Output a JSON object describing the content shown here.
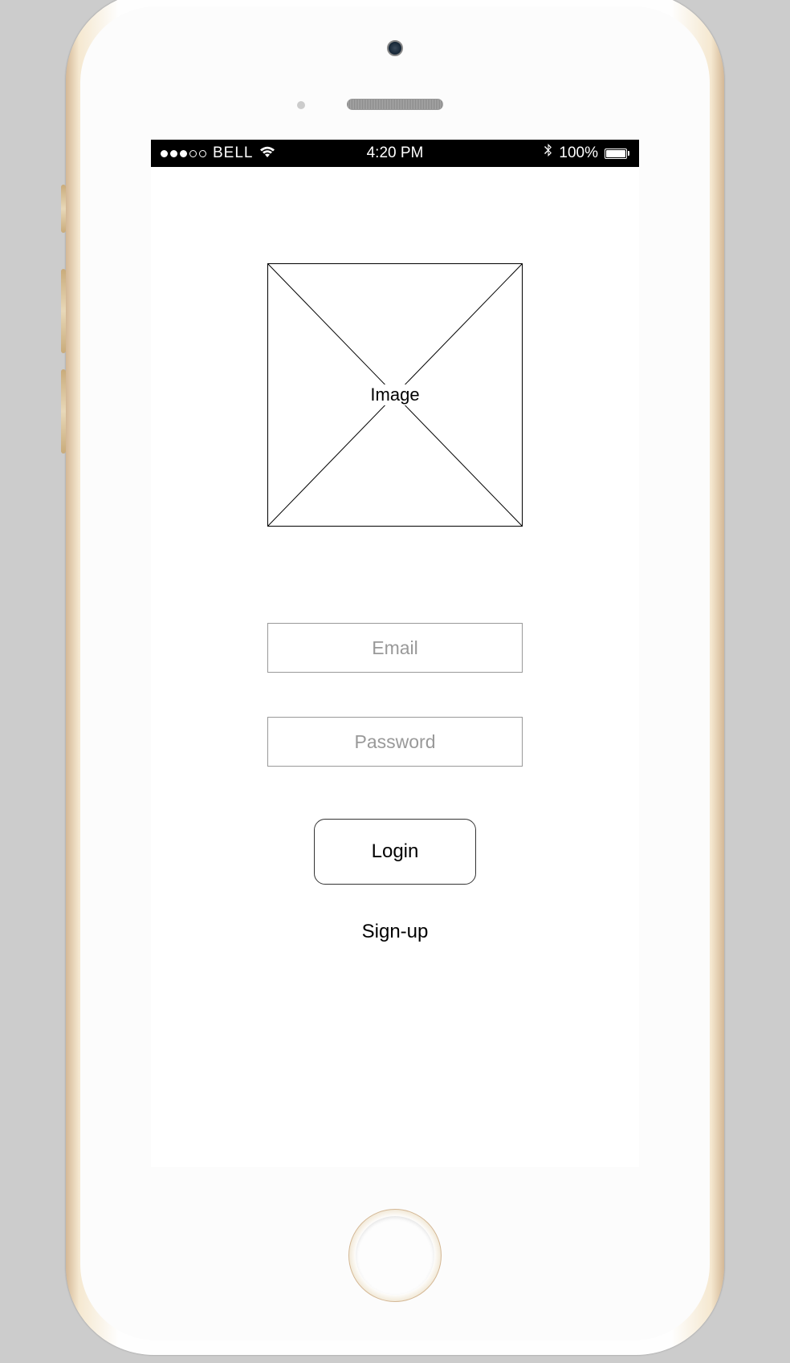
{
  "status_bar": {
    "carrier": "BELL",
    "time": "4:20 PM",
    "battery_percent": "100%"
  },
  "login_screen": {
    "image_label": "Image",
    "email_placeholder": "Email",
    "password_placeholder": "Password",
    "login_button": "Login",
    "signup_link": "Sign-up"
  }
}
